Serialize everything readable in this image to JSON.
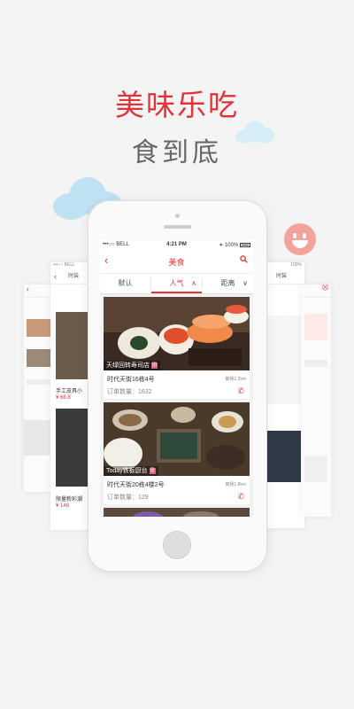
{
  "headline": {
    "title": "美味乐吃",
    "subtitle": "食到底"
  },
  "colors": {
    "accent": "#e0343a",
    "cloud": "#bfe3f3",
    "smiley": "#f4a39a"
  },
  "status_bar": {
    "carrier": "•••○○ BELL",
    "time": "4:21 PM",
    "battery": "100%"
  },
  "nav": {
    "title": "美食",
    "back_icon": "chevron-left-icon",
    "search_icon": "search-icon"
  },
  "filters": [
    {
      "label": "默认"
    },
    {
      "label": "人气",
      "chevron": "∧"
    },
    {
      "label": "距离",
      "chevron": "∨"
    }
  ],
  "restaurants": [
    {
      "name": "天绿回转寿司店",
      "badge": "团",
      "address": "时代天街16栋4号",
      "distance": "离我1.2km",
      "orders": "订单数量：1632"
    },
    {
      "name": "Today铁板厨台",
      "badge": "团",
      "address": "时代天街20栋4楼2号",
      "distance": "离我1.8km",
      "orders": "订单数量：129"
    }
  ],
  "bg_left": {
    "sb": "•••○○ BELL",
    "nav_label": "时装",
    "product_title": "手工皮具小",
    "product_price": "¥ 68.8",
    "bottom_title": "限量粉彩潮",
    "bottom_price": "¥ 148"
  },
  "bg_right": {
    "sb": "100%",
    "nav_label": "时装"
  }
}
